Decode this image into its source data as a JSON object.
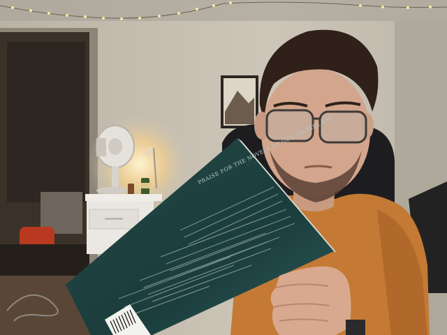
{
  "scene": {
    "book_back_cover_heading": "PRAISE FOR THE NOVELS OF GUY GAVRIEL KAY",
    "colors": {
      "wall": "#c9c2b4",
      "shirt": "#c47a34",
      "book": "#1f4140",
      "lamp_glow": "#ffe7b5",
      "door_dark": "#3a3129"
    },
    "icons": [
      "string-lights",
      "desk-fan",
      "desk-lamp",
      "framed-picture",
      "barcode"
    ]
  }
}
